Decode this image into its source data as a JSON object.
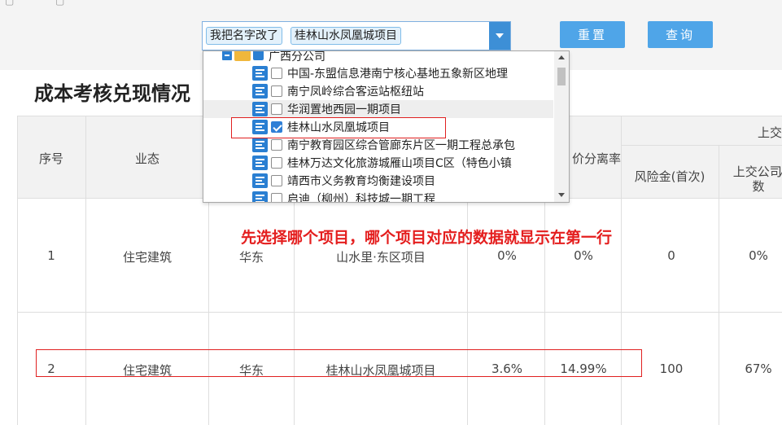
{
  "filter": {
    "tags": [
      "我把名字改了",
      "桂林山水凤凰城项目"
    ],
    "reset_label": "重置",
    "query_label": "查询"
  },
  "page": {
    "title": "成本考核兑现情况"
  },
  "table": {
    "headers": {
      "seq": "序号",
      "type": "业态",
      "rate_fragment": "价分离率",
      "group_fragment": "上交",
      "risk_first": "风险金(首次)",
      "turnover_fragment": "上交公司⁄",
      "count_fragment": "数"
    },
    "rows": [
      {
        "seq": "1",
        "type": "住宅建筑",
        "region": "华东",
        "project": "山水里·东区项目",
        "a": "0%",
        "b": "0%",
        "risk": "0",
        "ratio": "0%"
      },
      {
        "seq": "2",
        "type": "住宅建筑",
        "region": "华东",
        "project": "桂林山水凤凰城项目",
        "a": "3.6%",
        "b": "14.99%",
        "risk": "100",
        "ratio": "67%"
      }
    ]
  },
  "annotation": "先选择哪个项目，哪个项目对应的数据就显示在第一行",
  "dropdown": {
    "parent": "广西分公司",
    "items": [
      {
        "label": "中国-东盟信息港南宁核心基地五象新区地理",
        "checked": false
      },
      {
        "label": "南宁凤岭综合客运站枢纽站",
        "checked": false
      },
      {
        "label": "华润置地西园一期项目",
        "checked": false
      },
      {
        "label": "桂林山水凤凰城项目",
        "checked": true
      },
      {
        "label": "南宁教育园区综合管廊东片区一期工程总承包",
        "checked": false
      },
      {
        "label": "桂林万达文化旅游城雁山项目C区（特色小镇",
        "checked": false
      },
      {
        "label": "靖西市义务教育均衡建设项目",
        "checked": false
      },
      {
        "label": "启迪（柳州）科技城一期工程",
        "checked": false
      }
    ]
  },
  "colors": {
    "accent": "#4fa5e8",
    "annotation": "#e41e1e",
    "folder": "#f0b73c"
  },
  "icons": [
    "minus-square-icon",
    "folder-icon",
    "node-list-icon",
    "checkbox-icon",
    "chevron-down-icon"
  ]
}
